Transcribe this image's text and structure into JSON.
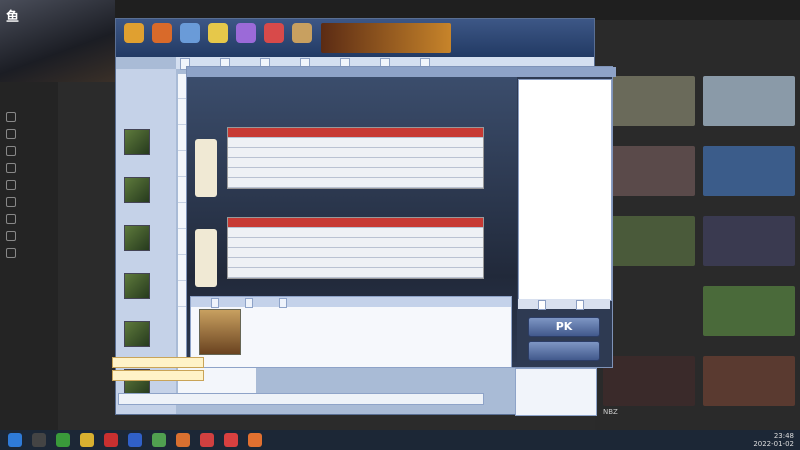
{
  "site": {
    "sidebar": [
      "",
      "",
      "",
      "",
      "",
      "",
      "",
      "",
      ""
    ],
    "right_cards": [
      {
        "title": "",
        "color": "#6a6a5a"
      },
      {
        "title": "",
        "color": "#8a9aa8"
      },
      {
        "title": "",
        "color": "#5a4a4a"
      },
      {
        "title": "",
        "color": "#3b5c8a"
      },
      {
        "title": "",
        "color": "#4a5a3a"
      },
      {
        "title": "",
        "color": "#3a3a50"
      },
      {
        "title": "",
        "color": "#2a2a2a"
      },
      {
        "title": "",
        "color": "#4a6a3a"
      },
      {
        "title": "NBZ",
        "color": "#3a2a2a"
      },
      {
        "title": "",
        "color": "#5a3a30"
      }
    ]
  },
  "overlay": {
    "line1": "",
    "line2": ""
  },
  "lobby": {
    "banner_labels": [
      "",
      "",
      "",
      "",
      "",
      "",
      ""
    ],
    "tabs": [
      "",
      "",
      "",
      "",
      "",
      "",
      ""
    ],
    "tiles": [
      "",
      "",
      "",
      "",
      "",
      ""
    ],
    "rooms": [
      "",
      "",
      "",
      "",
      "",
      "",
      "",
      "",
      ""
    ]
  },
  "table": {
    "title": "",
    "teams": [
      "",
      ""
    ],
    "rows_a": [
      {
        "open": "",
        "right": "",
        "hl": false
      },
      {
        "open": "",
        "right": "",
        "hl": false
      },
      {
        "open": "",
        "right": "",
        "hl": false
      },
      {
        "open": "",
        "right": "",
        "hl": false
      },
      {
        "open": "",
        "right": "",
        "hl": false
      }
    ],
    "rows_b": [
      {
        "open": "",
        "right": "",
        "hl": false
      },
      {
        "open": "",
        "right": "",
        "hl": false
      },
      {
        "open": "",
        "right": "",
        "hl": false
      },
      {
        "open": "",
        "right": "",
        "hl": false
      },
      {
        "open": "",
        "right": "",
        "hl": false
      }
    ]
  },
  "settings": {
    "title": "",
    "rows": [
      {
        "k": "",
        "v": ""
      },
      {
        "k": "",
        "v": ""
      },
      {
        "k": "",
        "v": ""
      },
      {
        "k": "",
        "v": ""
      },
      {
        "k": "",
        "v": ""
      },
      {
        "k": "",
        "v": ""
      },
      {
        "k": "",
        "v": ""
      },
      {
        "k": "",
        "v": ""
      },
      {
        "k": "",
        "v": ""
      },
      {
        "k": "",
        "v": ""
      },
      {
        "k": "",
        "v": ""
      },
      {
        "k": "",
        "v": ""
      },
      {
        "k": "",
        "v": ""
      },
      {
        "k": "",
        "v": ""
      },
      {
        "k": "",
        "v": ""
      },
      {
        "k": "",
        "v": ""
      }
    ],
    "note": "",
    "tabs": [
      "",
      ""
    ],
    "btn_cancel": "PK",
    "btn_exit": ""
  },
  "chat": {
    "tabs": [
      "",
      "",
      ""
    ],
    "lines": [
      "",
      "",
      "",
      ""
    ]
  },
  "notices": [
    "",
    ""
  ],
  "input_placeholder": "",
  "clock": {
    "time": "23:48",
    "date": "2022-01-02"
  }
}
